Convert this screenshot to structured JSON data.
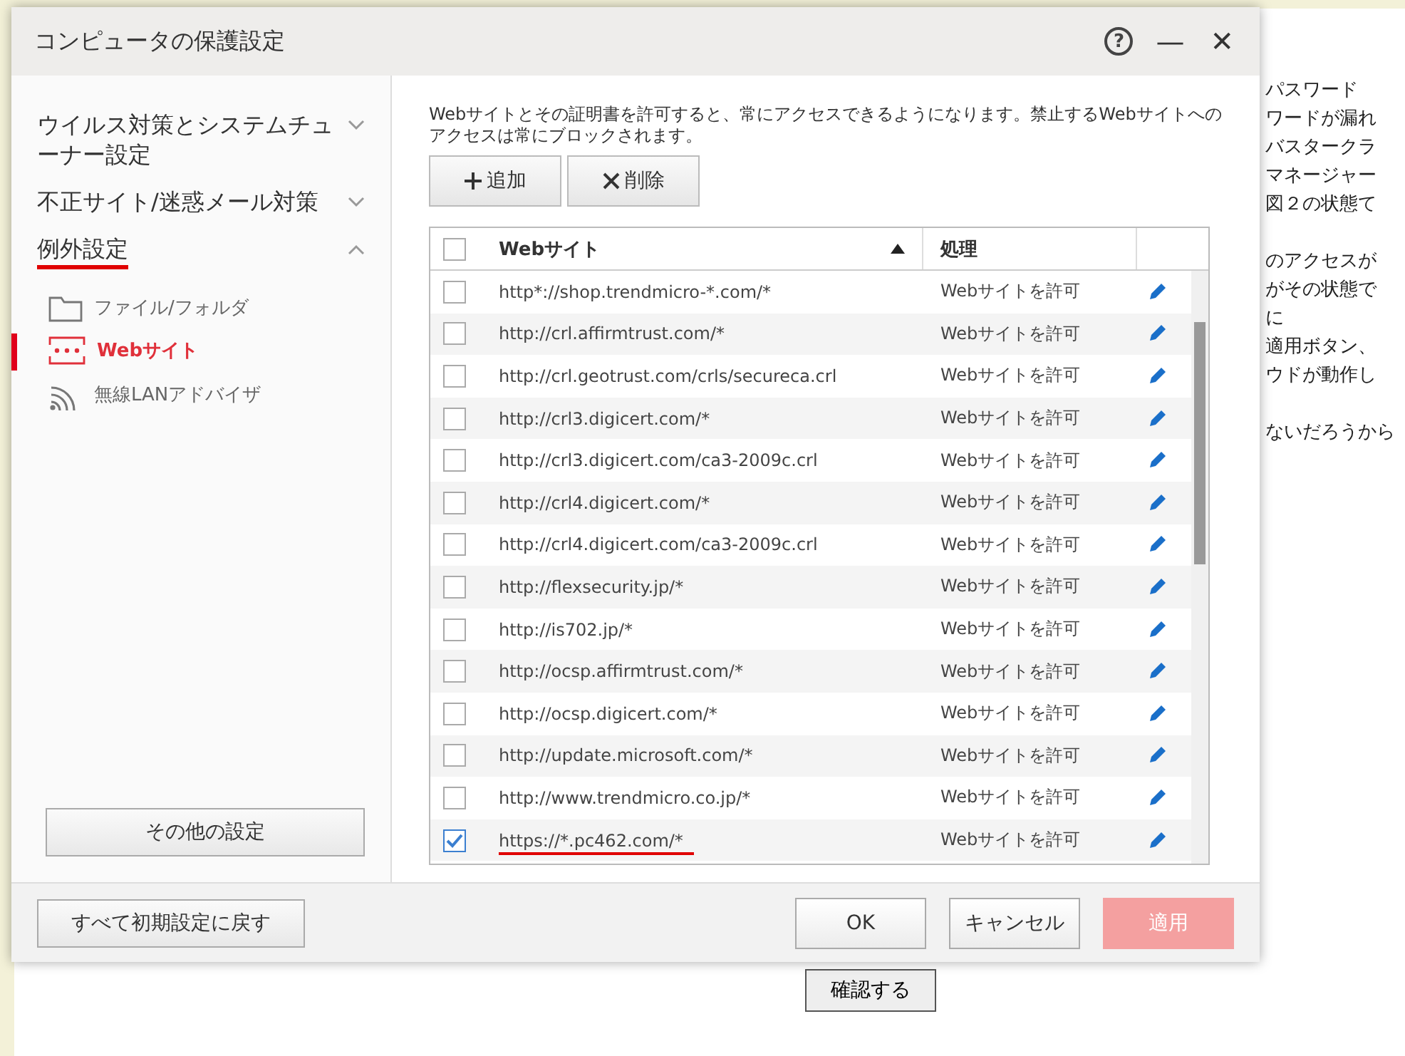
{
  "background": {
    "text_blocks": [
      [
        "パスワード",
        "ワードが漏れ",
        "バスタークラ",
        "マネージャー",
        "図２の状態て"
      ],
      [
        "のアクセスが",
        "がその状態で",
        "に",
        "適用ボタン、",
        "ウドが動作し"
      ],
      [
        "ないだろうから"
      ]
    ],
    "button": "確認する"
  },
  "window": {
    "title": "コンピュータの保護設定",
    "help": "?",
    "minimize": "—",
    "close": "✕"
  },
  "sidebar": {
    "sections": [
      {
        "label": "ウイルス対策とシステムチューナー設定",
        "expanded": false,
        "underlined": false
      },
      {
        "label": "不正サイト/迷惑メール対策",
        "expanded": false,
        "underlined": false
      },
      {
        "label": "例外設定",
        "expanded": true,
        "underlined": true,
        "children": [
          {
            "label": "ファイル/フォルダ",
            "selected": false
          },
          {
            "label": "Webサイト",
            "selected": true
          },
          {
            "label": "無線LANアドバイザ",
            "selected": false
          }
        ]
      }
    ],
    "other_button": "その他の設定"
  },
  "content": {
    "description": "Webサイトとその証明書を許可すると、常にアクセスできるようになります。禁止するWebサイトへのアクセスは常にブロックされます。",
    "toolbar": [
      {
        "label": "追加"
      },
      {
        "label": "削除"
      }
    ],
    "table": {
      "all_checked": false,
      "columns": [
        "Webサイト",
        "処理"
      ],
      "sort_ascending": true,
      "rows": [
        {
          "url": "http*://shop.trendmicro-*.com/*",
          "action": "Webサイトを許可",
          "checked": false,
          "underlined": false
        },
        {
          "url": "http://crl.affirmtrust.com/*",
          "action": "Webサイトを許可",
          "checked": false,
          "underlined": false
        },
        {
          "url": "http://crl.geotrust.com/crls/secureca.crl",
          "action": "Webサイトを許可",
          "checked": false,
          "underlined": false
        },
        {
          "url": "http://crl3.digicert.com/*",
          "action": "Webサイトを許可",
          "checked": false,
          "underlined": false
        },
        {
          "url": "http://crl3.digicert.com/ca3-2009c.crl",
          "action": "Webサイトを許可",
          "checked": false,
          "underlined": false
        },
        {
          "url": "http://crl4.digicert.com/*",
          "action": "Webサイトを許可",
          "checked": false,
          "underlined": false
        },
        {
          "url": "http://crl4.digicert.com/ca3-2009c.crl",
          "action": "Webサイトを許可",
          "checked": false,
          "underlined": false
        },
        {
          "url": "http://flexsecurity.jp/*",
          "action": "Webサイトを許可",
          "checked": false,
          "underlined": false
        },
        {
          "url": "http://is702.jp/*",
          "action": "Webサイトを許可",
          "checked": false,
          "underlined": false
        },
        {
          "url": "http://ocsp.affirmtrust.com/*",
          "action": "Webサイトを許可",
          "checked": false,
          "underlined": false
        },
        {
          "url": "http://ocsp.digicert.com/*",
          "action": "Webサイトを許可",
          "checked": false,
          "underlined": false
        },
        {
          "url": "http://update.microsoft.com/*",
          "action": "Webサイトを許可",
          "checked": false,
          "underlined": false
        },
        {
          "url": "http://www.trendmicro.co.jp/*",
          "action": "Webサイトを許可",
          "checked": false,
          "underlined": false
        },
        {
          "url": "https://*.pc462.com/*",
          "action": "Webサイトを許可",
          "checked": true,
          "underlined": true
        }
      ]
    }
  },
  "footer": {
    "reset": "すべて初期設定に戻す",
    "buttons": [
      {
        "label": "OK",
        "disabled": false
      },
      {
        "label": "キャンセル",
        "disabled": false
      },
      {
        "label": "適用",
        "disabled": true
      }
    ]
  }
}
